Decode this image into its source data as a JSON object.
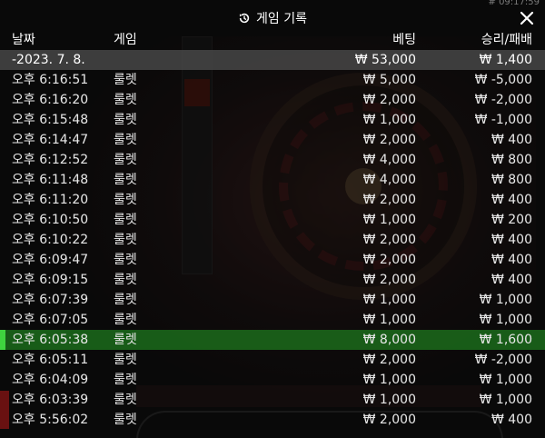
{
  "top_right_time": "# 09:17:59",
  "dialog": {
    "title": "게임 기록",
    "close_label": "✕"
  },
  "columns": {
    "date": "날짜",
    "game": "게임",
    "bet": "베팅",
    "winloss": "승리/패배"
  },
  "date_row": {
    "date": "-2023. 7. 8.",
    "bet": "₩ 53,000",
    "winloss": "₩ 1,400"
  },
  "rows": [
    {
      "time": "오후 6:16:51",
      "game": "룰렛",
      "bet": "₩ 5,000",
      "winloss": "₩ -5,000"
    },
    {
      "time": "오후 6:16:20",
      "game": "룰렛",
      "bet": "₩ 2,000",
      "winloss": "₩ -2,000"
    },
    {
      "time": "오후 6:15:48",
      "game": "룰렛",
      "bet": "₩ 1,000",
      "winloss": "₩ -1,000"
    },
    {
      "time": "오후 6:14:47",
      "game": "룰렛",
      "bet": "₩ 2,000",
      "winloss": "₩ 400"
    },
    {
      "time": "오후 6:12:52",
      "game": "룰렛",
      "bet": "₩ 4,000",
      "winloss": "₩ 800"
    },
    {
      "time": "오후 6:11:48",
      "game": "룰렛",
      "bet": "₩ 4,000",
      "winloss": "₩ 800"
    },
    {
      "time": "오후 6:11:20",
      "game": "룰렛",
      "bet": "₩ 2,000",
      "winloss": "₩ 400"
    },
    {
      "time": "오후 6:10:50",
      "game": "룰렛",
      "bet": "₩ 1,000",
      "winloss": "₩ 200"
    },
    {
      "time": "오후 6:10:22",
      "game": "룰렛",
      "bet": "₩ 2,000",
      "winloss": "₩ 400"
    },
    {
      "time": "오후 6:09:47",
      "game": "룰렛",
      "bet": "₩ 2,000",
      "winloss": "₩ 400"
    },
    {
      "time": "오후 6:09:15",
      "game": "룰렛",
      "bet": "₩ 2,000",
      "winloss": "₩ 400"
    },
    {
      "time": "오후 6:07:39",
      "game": "룰렛",
      "bet": "₩ 1,000",
      "winloss": "₩ 1,000"
    },
    {
      "time": "오후 6:07:05",
      "game": "룰렛",
      "bet": "₩ 1,000",
      "winloss": "₩ 1,000"
    },
    {
      "time": "오후 6:05:38",
      "game": "룰렛",
      "bet": "₩ 8,000",
      "winloss": "₩ 1,600",
      "highlight": true
    },
    {
      "time": "오후 6:05:11",
      "game": "룰렛",
      "bet": "₩ 2,000",
      "winloss": "₩ -2,000"
    },
    {
      "time": "오후 6:04:09",
      "game": "룰렛",
      "bet": "₩ 1,000",
      "winloss": "₩ 1,000"
    },
    {
      "time": "오후 6:03:39",
      "game": "룰렛",
      "bet": "₩ 1,000",
      "winloss": "₩ 1,000"
    },
    {
      "time": "오후 5:56:02",
      "game": "룰렛",
      "bet": "₩ 2,000",
      "winloss": "₩ 400"
    }
  ],
  "colors": {
    "highlight_bg": "#1e781e",
    "highlight_bar": "#3fd43f",
    "date_row_bg": "#464646"
  }
}
